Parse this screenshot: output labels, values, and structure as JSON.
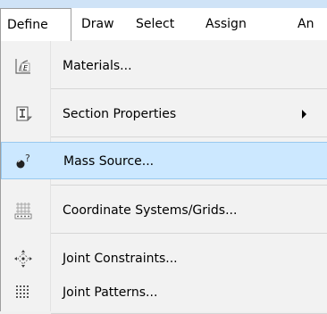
{
  "menubar": {
    "items": [
      {
        "label": "Define"
      },
      {
        "label": "Draw"
      },
      {
        "label": "Select"
      },
      {
        "label": "Assign"
      },
      {
        "label": "An"
      }
    ]
  },
  "menu": {
    "items": [
      {
        "label": "Materials...",
        "icon": "materials-icon"
      },
      {
        "label": "Section Properties",
        "icon": "section-properties-icon",
        "submenu": true
      },
      {
        "label": "Mass Source...",
        "icon": "mass-source-icon",
        "highlighted": true
      },
      {
        "label": "Coordinate Systems/Grids...",
        "icon": "coordinate-grid-icon"
      },
      {
        "label": "Joint Constraints...",
        "icon": "joint-constraints-icon"
      },
      {
        "label": "Joint Patterns...",
        "icon": "joint-patterns-icon"
      }
    ]
  },
  "colors": {
    "highlight": "#cce8ff",
    "highlight_border": "#99c9ef",
    "menu_bg": "#f2f2f2"
  }
}
